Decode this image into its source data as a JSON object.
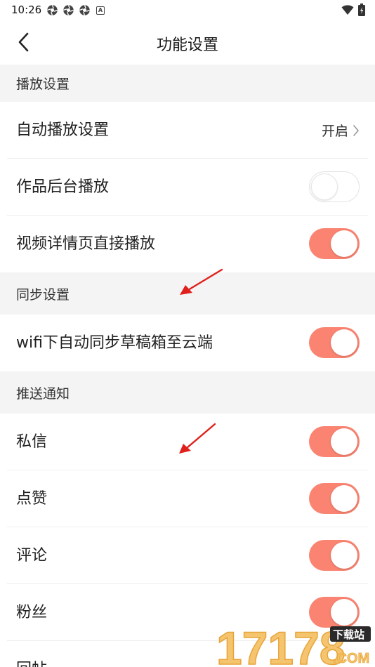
{
  "status_bar": {
    "time": "10:26",
    "badge_letter": "A"
  },
  "nav": {
    "title": "功能设置"
  },
  "sections": {
    "playback": {
      "header": "播放设置",
      "auto_play": {
        "label": "自动播放设置",
        "value": "开启"
      },
      "background_play": {
        "label": "作品后台播放",
        "on": false
      },
      "detail_play": {
        "label": "视频详情页直接播放",
        "on": true
      }
    },
    "sync": {
      "header": "同步设置",
      "wifi_sync": {
        "label": "wifi下自动同步草稿箱至云端",
        "on": true
      }
    },
    "push": {
      "header": "推送通知",
      "items": [
        {
          "label": "私信",
          "on": true
        },
        {
          "label": "点赞",
          "on": true
        },
        {
          "label": "评论",
          "on": true
        },
        {
          "label": "粉丝",
          "on": true
        },
        {
          "label": "回帖"
        }
      ]
    }
  },
  "watermark": {
    "number": "17178",
    "badge": "下载站",
    "suffix": ".COM"
  },
  "colors": {
    "toggle_on": "#fa8471",
    "section_bg": "#f4f4f4",
    "arrow": "#e0201c"
  }
}
